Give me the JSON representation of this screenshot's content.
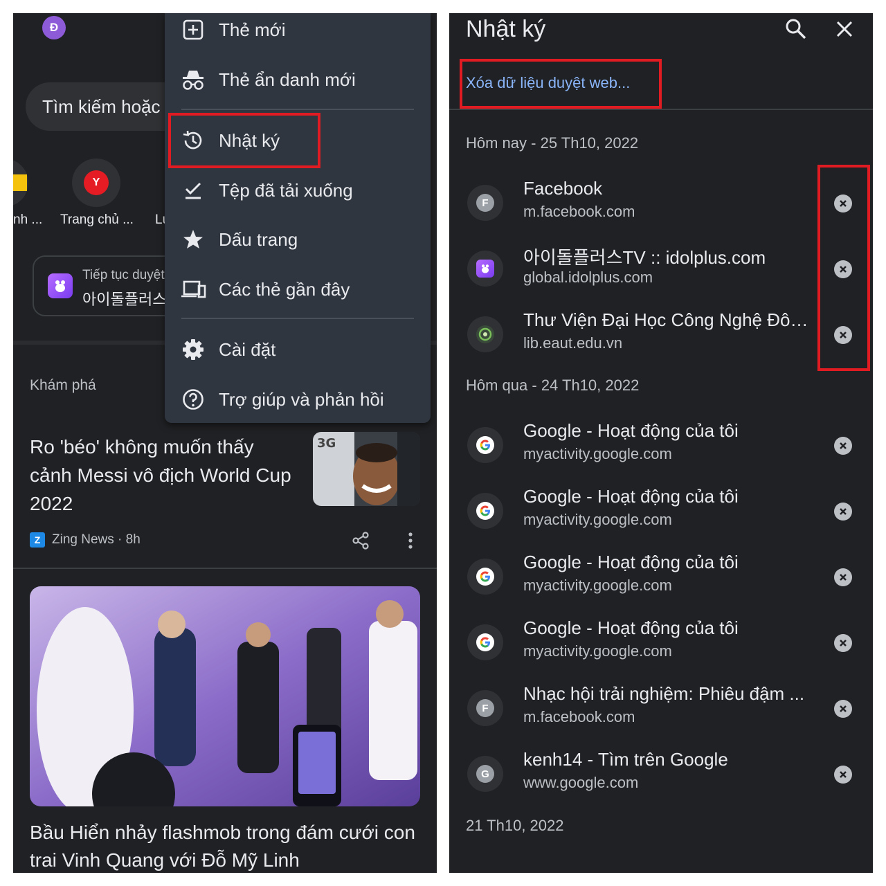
{
  "left": {
    "avatar_letter": "Đ",
    "search_placeholder": "Tìm kiếm hoặc",
    "tiles": [
      {
        "label": "nh ...",
        "icon": "yellow-tile-icon"
      },
      {
        "label": "Trang chủ ...",
        "icon": "youtube-y-icon",
        "letter": "Y"
      },
      {
        "label": "Lu",
        "icon": "tile-icon"
      }
    ],
    "continue_card": {
      "title": "Tiếp tục duyệt",
      "subtitle": "아이돌플러스"
    },
    "discover_label": "Khám phá",
    "article1": {
      "title": "Ro 'béo' không muốn thấy cảnh Messi vô địch World Cup 2022",
      "source": "Zing News · 8h",
      "source_logo": "Z"
    },
    "article2": {
      "title": "Bầu Hiển nhảy flashmob trong đám cưới con trai Vinh Quang với Đỗ Mỹ Linh"
    },
    "menu": {
      "items": [
        {
          "label": "Thẻ mới",
          "icon": "new-tab-icon"
        },
        {
          "label": "Thẻ ẩn danh mới",
          "icon": "incognito-icon"
        },
        {
          "label": "Nhật ký",
          "icon": "history-icon"
        },
        {
          "label": "Tệp đã tải xuống",
          "icon": "downloads-icon"
        },
        {
          "label": "Dấu trang",
          "icon": "star-icon"
        },
        {
          "label": "Các thẻ gần đây",
          "icon": "recent-tabs-icon"
        },
        {
          "label": "Cài đặt",
          "icon": "settings-icon"
        },
        {
          "label": "Trợ giúp và phản hồi",
          "icon": "help-icon"
        }
      ]
    }
  },
  "right": {
    "title": "Nhật ký",
    "clear_link": "Xóa dữ liệu duyệt web...",
    "groups": [
      {
        "date": "Hôm nay - 25 Th10, 2022",
        "entries": [
          {
            "title": "Facebook",
            "url": "m.facebook.com",
            "favicon": "F"
          },
          {
            "title": "아이돌플러스TV :: idolplus.com",
            "url": "global.idolplus.com",
            "favicon": "idolplus"
          },
          {
            "title": "Thư Viện Đại Học Công Nghệ Đông Á",
            "url": "lib.eaut.edu.vn",
            "favicon": "eaut"
          }
        ]
      },
      {
        "date": "Hôm qua - 24 Th10, 2022",
        "entries": [
          {
            "title": "Google - Hoạt động của tôi",
            "url": "myactivity.google.com",
            "favicon": "G"
          },
          {
            "title": "Google - Hoạt động của tôi",
            "url": "myactivity.google.com",
            "favicon": "G"
          },
          {
            "title": "Google - Hoạt động của tôi",
            "url": "myactivity.google.com",
            "favicon": "G"
          },
          {
            "title": "Google - Hoạt động của tôi",
            "url": "myactivity.google.com",
            "favicon": "G"
          },
          {
            "title": "Nhạc hội trải nghiệm: Phiêu đậm ...",
            "url": "m.facebook.com",
            "favicon": "F"
          },
          {
            "title": "kenh14 - Tìm trên Google",
            "url": "www.google.com",
            "favicon": "G-gray"
          }
        ]
      },
      {
        "date": "21 Th10, 2022",
        "entries": []
      }
    ]
  },
  "colors": {
    "background": "#202124",
    "menu": "#303640",
    "link": "#8ab4f8",
    "highlight": "#e11b22"
  }
}
